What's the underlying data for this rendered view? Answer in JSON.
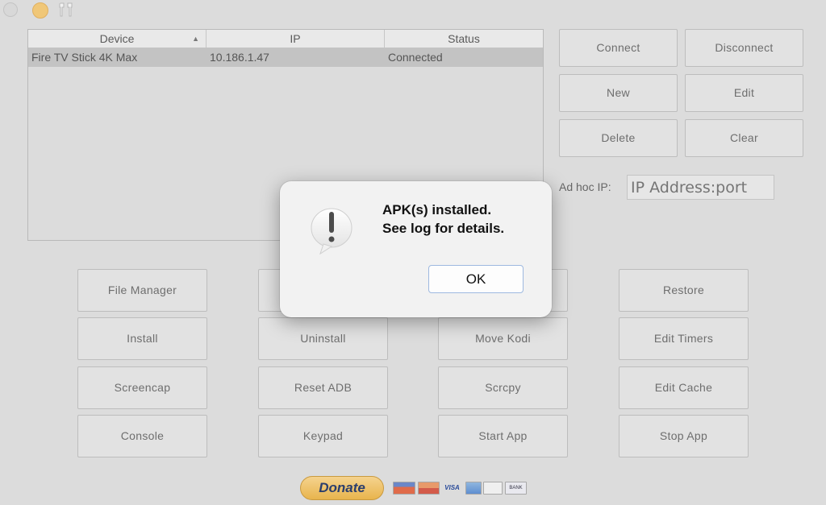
{
  "table": {
    "columns": [
      "Device",
      "IP",
      "Status"
    ],
    "rows": [
      {
        "device": "Fire TV Stick 4K Max",
        "ip": "10.186.1.47",
        "status": "Connected"
      }
    ]
  },
  "right_buttons": {
    "connect": "Connect",
    "disconnect": "Disconnect",
    "new": "New",
    "edit": "Edit",
    "delete": "Delete",
    "clear": "Clear"
  },
  "adhoc": {
    "label": "Ad hoc IP:",
    "placeholder": "IP Address:port"
  },
  "grid_buttons": {
    "file_manager": "File Manager",
    "restore": "Restore",
    "install": "Install",
    "uninstall": "Uninstall",
    "move_kodi": "Move Kodi",
    "edit_timers": "Edit Timers",
    "screencap": "Screencap",
    "reset_adb": "Reset ADB",
    "scrcpy": "Scrcpy",
    "edit_cache": "Edit Cache",
    "console": "Console",
    "keypad": "Keypad",
    "start_app": "Start App",
    "stop_app": "Stop App"
  },
  "donate": {
    "label": "Donate",
    "card_labels": {
      "visa": "VISA",
      "bank": "BANK"
    }
  },
  "dialog": {
    "line1": "APK(s) installed.",
    "line2": "See log for details.",
    "ok": "OK"
  },
  "colors": {
    "background": "#dcdcdc",
    "selected_row": "#c3c3c3",
    "donate_gold": "#f0c36a",
    "ok_border": "#9eb9e0"
  }
}
